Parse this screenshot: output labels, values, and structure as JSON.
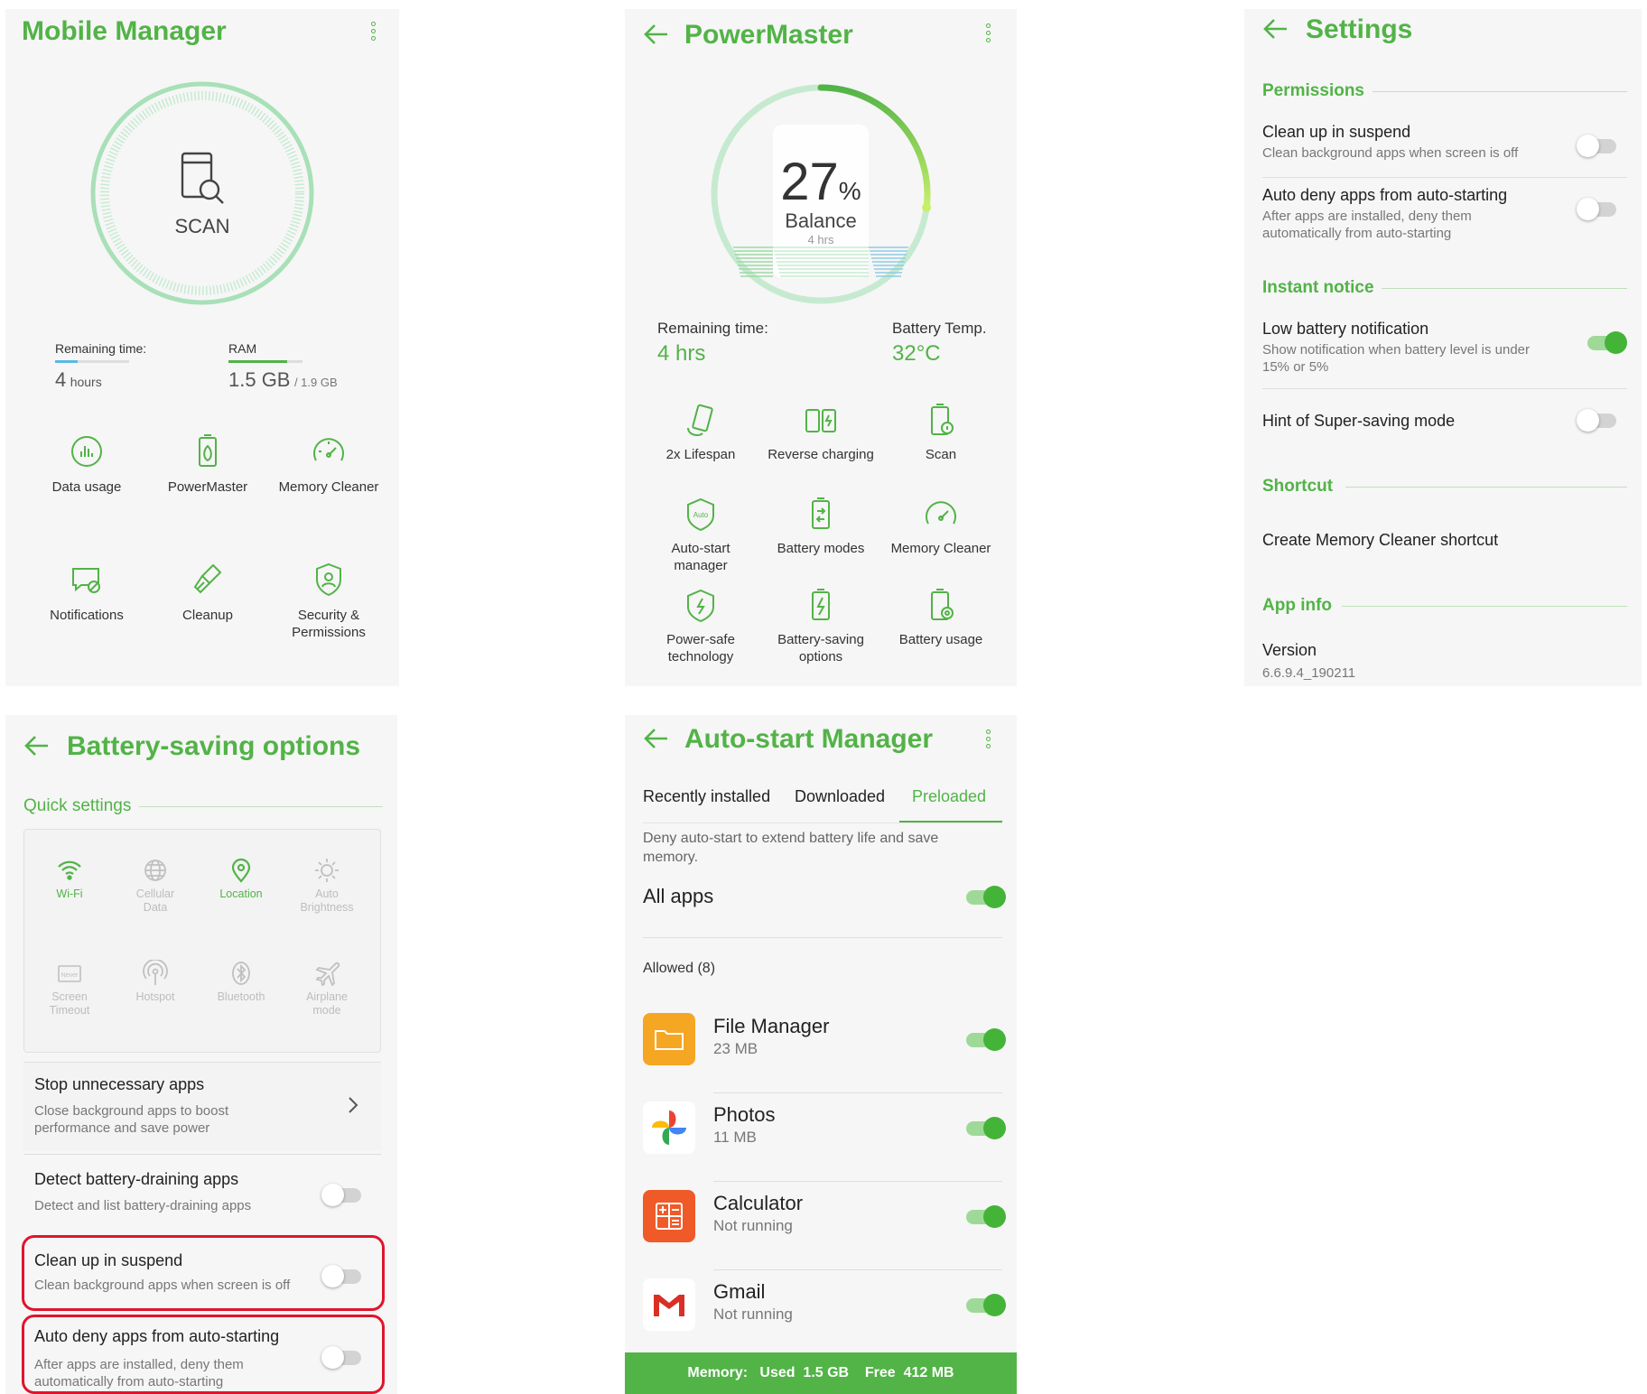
{
  "mobile_manager": {
    "title": "Mobile Manager",
    "scan_label": "SCAN",
    "remaining_label": "Remaining time:",
    "remaining_value": "4",
    "remaining_unit": "hours",
    "ram_label": "RAM",
    "ram_value": "1.5 GB",
    "ram_total": "/ 1.9 GB",
    "ram_fraction": 0.79,
    "remaining_fraction": 0.3,
    "tiles": [
      {
        "label": "Data usage",
        "icon": "data-usage-icon"
      },
      {
        "label": "PowerMaster",
        "icon": "powermaster-icon"
      },
      {
        "label": "Memory Cleaner",
        "icon": "memory-cleaner-icon"
      },
      {
        "label": "Notifications",
        "icon": "notifications-icon"
      },
      {
        "label": "Cleanup",
        "icon": "cleanup-icon"
      },
      {
        "label": "Security &\nPermissions",
        "icon": "security-icon"
      }
    ]
  },
  "powermaster": {
    "title": "PowerMaster",
    "percent": "27",
    "percent_sign": "%",
    "balance_label": "Balance",
    "balance_sub": "4 hrs",
    "battery_level": 0.27,
    "remaining_label": "Remaining time:",
    "remaining_value": "4 hrs",
    "temp_label": "Battery Temp.",
    "temp_value": "32°C",
    "tiles": [
      {
        "label": "2x Lifespan",
        "icon": "lifespan-icon"
      },
      {
        "label": "Reverse charging",
        "icon": "reverse-charging-icon"
      },
      {
        "label": "Scan",
        "icon": "scan-icon"
      },
      {
        "label": "Auto-start\nmanager",
        "icon": "auto-start-icon"
      },
      {
        "label": "Battery modes",
        "icon": "battery-modes-icon"
      },
      {
        "label": "Memory Cleaner",
        "icon": "memory-cleaner-icon"
      },
      {
        "label": "Power-safe\ntechnology",
        "icon": "power-safe-icon"
      },
      {
        "label": "Battery-saving\noptions",
        "icon": "battery-saving-icon"
      },
      {
        "label": "Battery usage",
        "icon": "battery-usage-icon"
      }
    ],
    "auto_icon_text": "Auto"
  },
  "settings": {
    "title": "Settings",
    "sections": {
      "permissions": "Permissions",
      "instant_notice": "Instant notice",
      "shortcut": "Shortcut",
      "app_info": "App info"
    },
    "rows": {
      "cleanup_title": "Clean up in suspend",
      "cleanup_sub": "Clean background apps when screen is off",
      "cleanup_on": false,
      "autodeny_title": "Auto deny apps from auto-starting",
      "autodeny_sub": "After apps are installed, deny them automatically from auto-starting",
      "autodeny_on": false,
      "lowbatt_title": "Low battery notification",
      "lowbatt_sub": "Show notification when battery level is under 15% or 5%",
      "lowbatt_on": true,
      "hint_title": "Hint of Super-saving mode",
      "hint_on": false,
      "shortcut_title": "Create Memory Cleaner shortcut",
      "version_title": "Version",
      "version_value": "6.6.9.4_190211"
    }
  },
  "battery_saving": {
    "title": "Battery-saving options",
    "quick_settings": "Quick settings",
    "qs": [
      {
        "label": "Wi-Fi",
        "on": true,
        "icon": "wifi-icon"
      },
      {
        "label": "Cellular\nData",
        "on": false,
        "icon": "cellular-data-icon"
      },
      {
        "label": "Location",
        "on": true,
        "icon": "location-icon"
      },
      {
        "label": "Auto\nBrightness",
        "on": false,
        "icon": "brightness-icon"
      },
      {
        "label": "Screen\nTimeout",
        "on": false,
        "icon": "screen-timeout-icon"
      },
      {
        "label": "Hotspot",
        "on": false,
        "icon": "hotspot-icon"
      },
      {
        "label": "Bluetooth",
        "on": false,
        "icon": "bluetooth-icon"
      },
      {
        "label": "Airplane\nmode",
        "on": false,
        "icon": "airplane-icon"
      }
    ],
    "never_text": "Never",
    "rows": {
      "stop_title": "Stop unnecessary apps",
      "stop_sub": "Close background apps to boost performance and save power",
      "detect_title": "Detect battery-draining apps",
      "detect_sub": "Detect and list battery-draining apps",
      "detect_on": false,
      "cleanup_title": "Clean up in suspend",
      "cleanup_sub": "Clean background apps when screen is off",
      "cleanup_on": false,
      "autodeny_title": "Auto deny apps from auto-starting",
      "autodeny_sub": "After apps are installed, deny them automatically from auto-starting",
      "autodeny_on": false
    }
  },
  "autostart": {
    "title": "Auto-start Manager",
    "tabs": [
      "Recently installed",
      "Downloaded",
      "Preloaded"
    ],
    "active_tab": "Preloaded",
    "description": "Deny auto-start to extend battery life and save memory.",
    "all_apps": "All apps",
    "all_apps_on": true,
    "allowed_header": "Allowed (8)",
    "apps": [
      {
        "name": "File Manager",
        "sub": "23 MB",
        "on": true,
        "icon": "file-manager-icon"
      },
      {
        "name": "Photos",
        "sub": "11 MB",
        "on": true,
        "icon": "photos-icon"
      },
      {
        "name": "Calculator",
        "sub": "Not running",
        "on": true,
        "icon": "calculator-icon"
      },
      {
        "name": "Gmail",
        "sub": "Not running",
        "on": true,
        "icon": "gmail-icon"
      }
    ],
    "footer": {
      "memory_label": "Memory:",
      "used_label": "Used",
      "used_value": "1.5 GB",
      "free_label": "Free",
      "free_value": "412 MB"
    }
  },
  "colors": {
    "accent": "#52b347",
    "panel_bg": "#f6f6f6",
    "highlight": "#e0142b"
  }
}
